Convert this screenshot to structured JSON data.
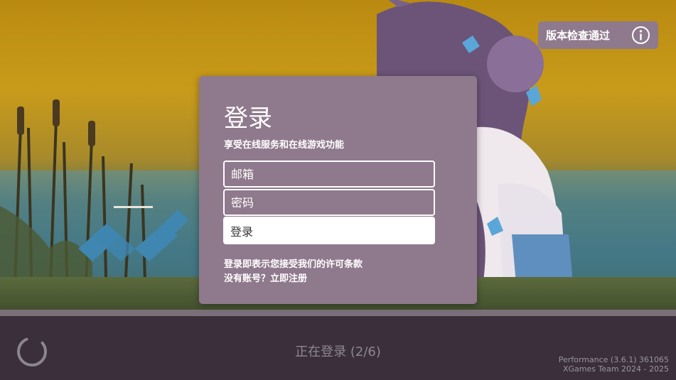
{
  "version_badge": {
    "label": "版本检查通过",
    "icon": "info-icon"
  },
  "login_dialog": {
    "title": "登录",
    "subtitle": "享受在线服务和在线游戏功能",
    "email_placeholder": "邮箱",
    "password_placeholder": "密码",
    "submit_label": "登录",
    "terms_text": "登录即表示您接受我们的许可条款",
    "register_text": "没有账号？立即注册"
  },
  "status_bar": {
    "status_text": "正在登录 (2/6)",
    "spinner_icon": "loading-spinner-icon",
    "performance_line": "Performance (3.6.1) 361065",
    "credits_line": "XGames Team 2024 - 2025"
  },
  "colors": {
    "dialog_bg": "#8f798c",
    "badge_bg": "#8e7a8c",
    "bottom_bar_bg": "#3a2f3a"
  }
}
